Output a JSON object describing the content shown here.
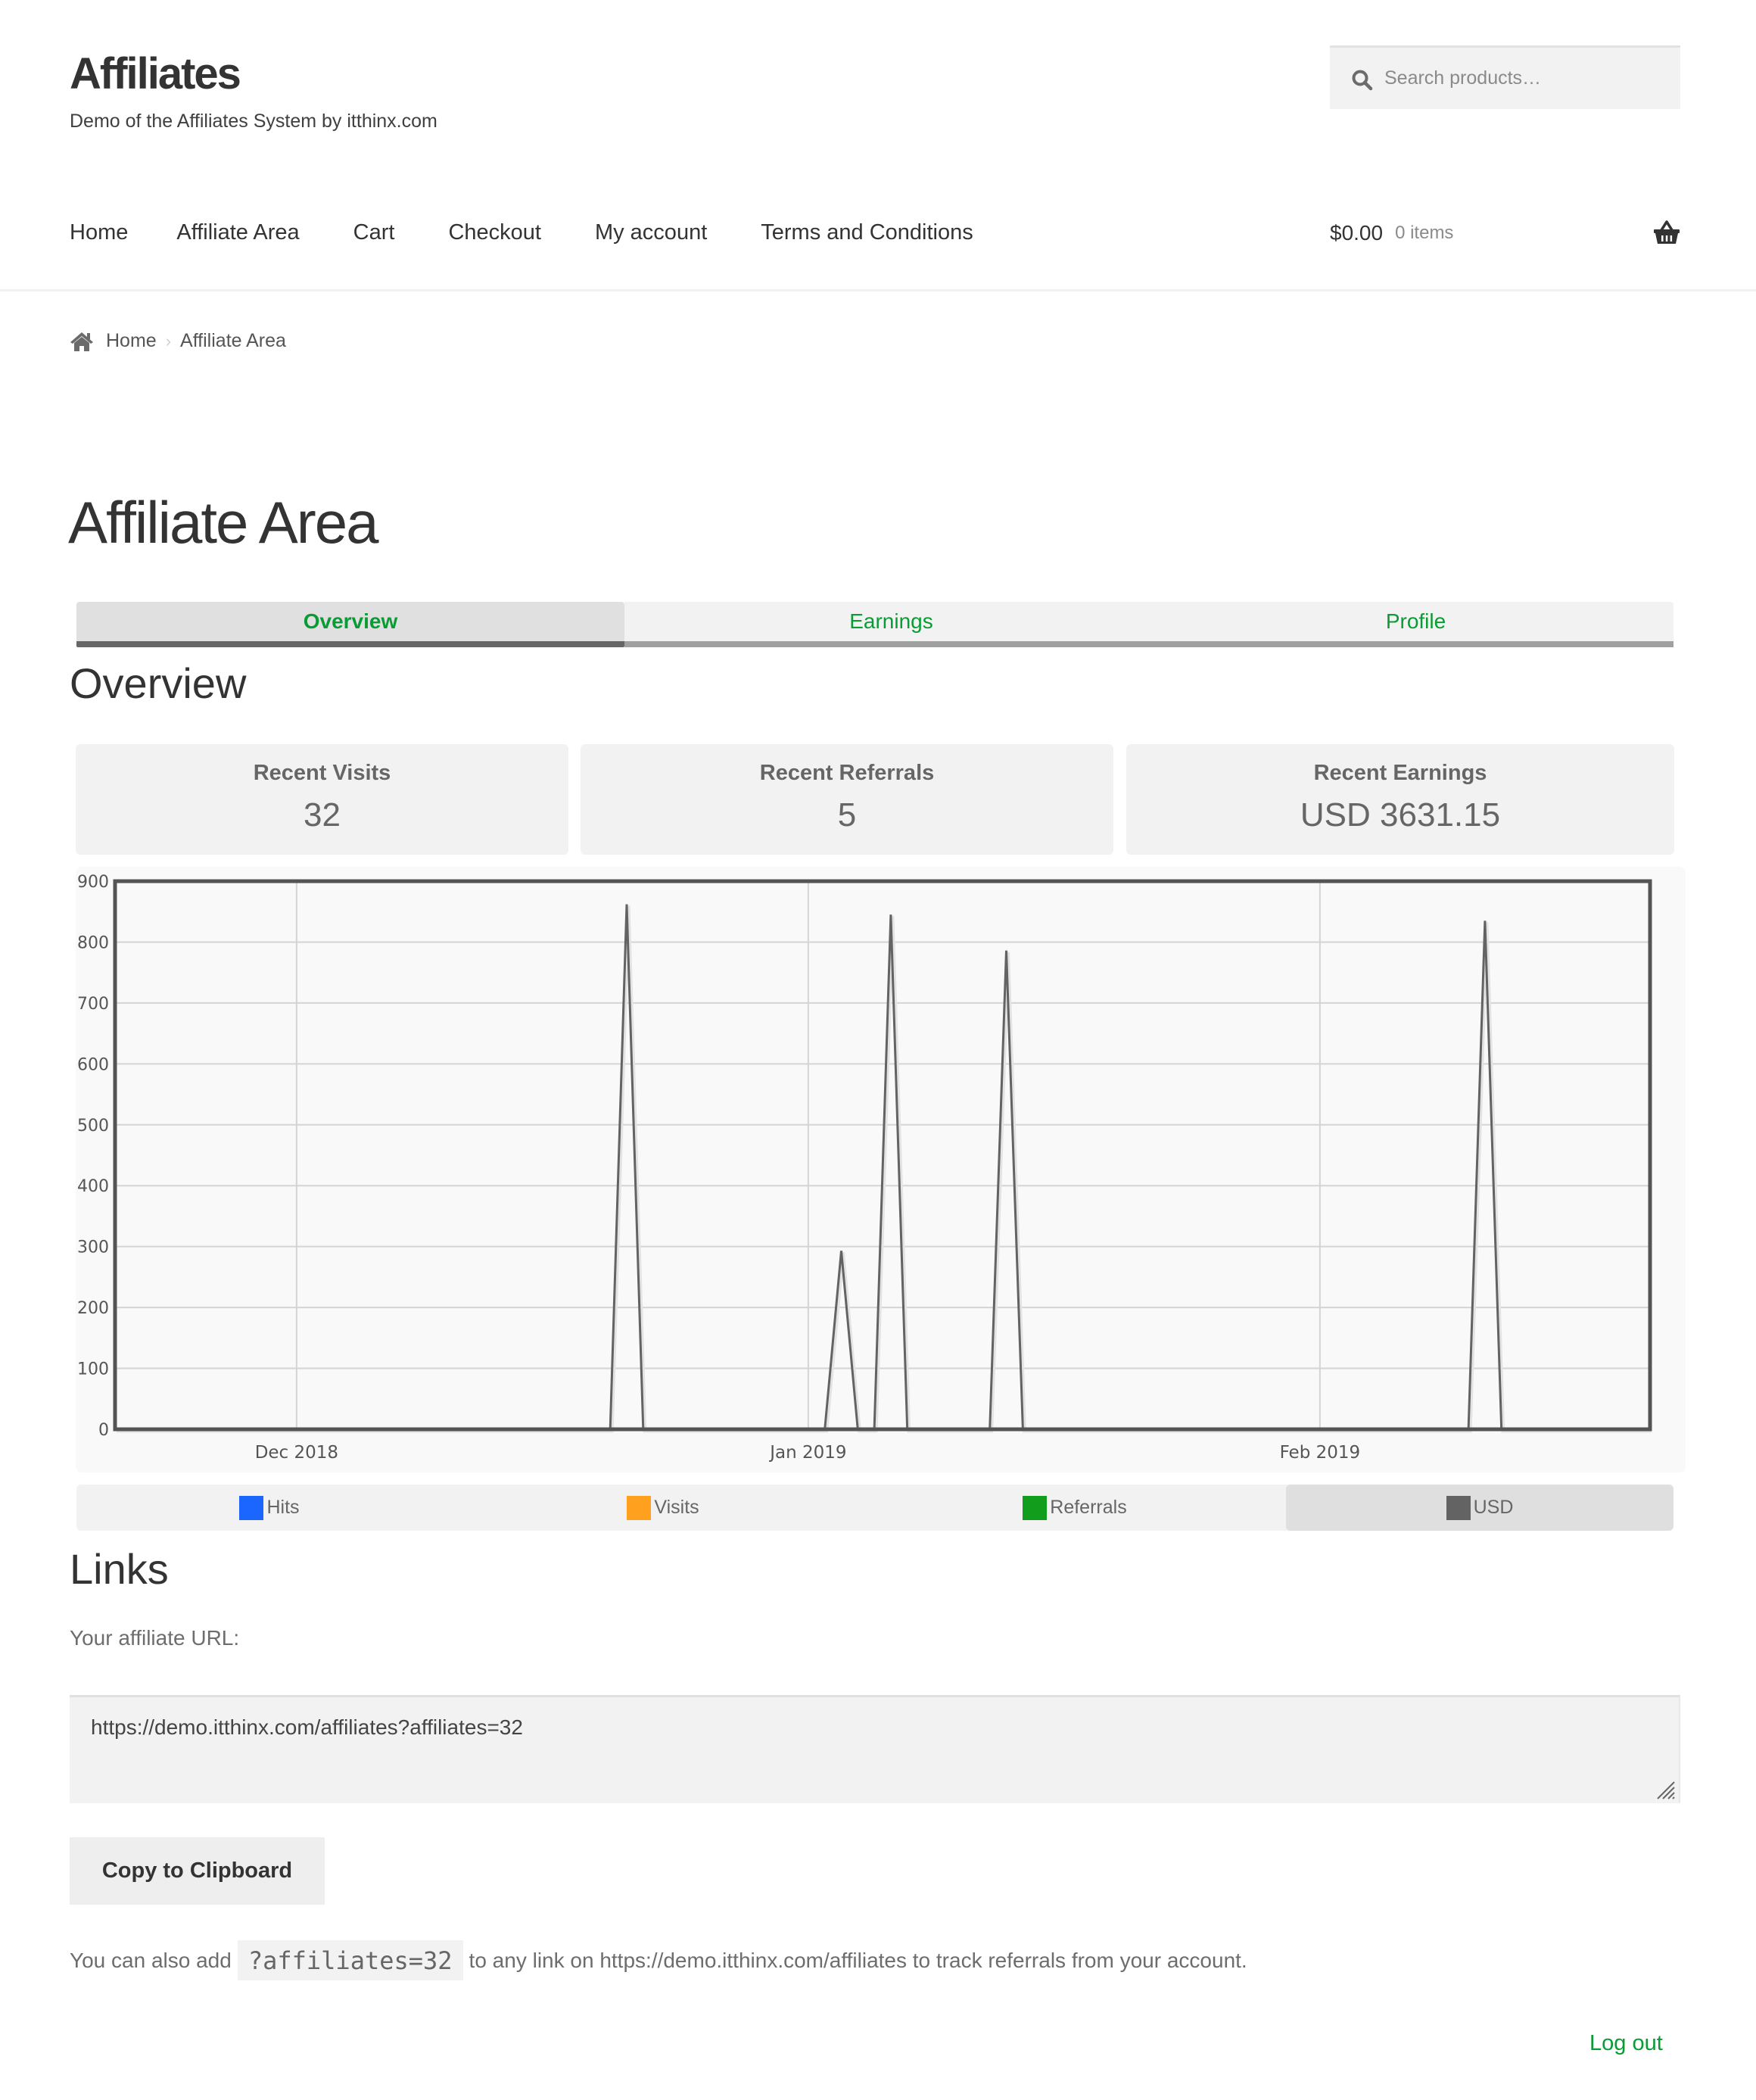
{
  "header": {
    "site_title": "Affiliates",
    "site_description": "Demo of the Affiliates System by itthinx.com",
    "search": {
      "placeholder": "Search products…",
      "value": "",
      "icon": "search-icon"
    },
    "cart": {
      "amount": "$0.00",
      "count": "0 items",
      "icon": "basket-icon"
    }
  },
  "nav": {
    "items": [
      {
        "label": "Home"
      },
      {
        "label": "Affiliate Area"
      },
      {
        "label": "Cart"
      },
      {
        "label": "Checkout"
      },
      {
        "label": "My account"
      },
      {
        "label": "Terms and Conditions"
      }
    ]
  },
  "breadcrumb": {
    "icon": "home-icon",
    "items": [
      {
        "label": "Home"
      },
      {
        "label": "Affiliate Area"
      }
    ],
    "separator": "›"
  },
  "page": {
    "title": "Affiliate Area",
    "tabs": [
      {
        "label": "Overview",
        "active": true
      },
      {
        "label": "Earnings",
        "active": false
      },
      {
        "label": "Profile",
        "active": false
      }
    ]
  },
  "overview": {
    "heading": "Overview",
    "stats": [
      {
        "label": "Recent Visits",
        "value": "32"
      },
      {
        "label": "Recent Referrals",
        "value": "5"
      },
      {
        "label": "Recent Earnings",
        "value": "USD 3631.15"
      }
    ]
  },
  "legend": {
    "items": [
      {
        "label": "Hits",
        "color": "#1a66ff",
        "active": false
      },
      {
        "label": "Visits",
        "color": "#ffa01e",
        "active": false
      },
      {
        "label": "Referrals",
        "color": "#129e1c",
        "active": false
      },
      {
        "label": "USD",
        "color": "#636363",
        "active": true
      }
    ]
  },
  "chart_data": {
    "type": "line",
    "title": "",
    "xlabel": "",
    "ylabel": "",
    "x_range": [
      "2018-11-20",
      "2019-02-21"
    ],
    "ylim": [
      0,
      900
    ],
    "y_ticks": [
      0,
      100,
      200,
      300,
      400,
      500,
      600,
      700,
      800,
      900
    ],
    "y_tick_labels": [
      "0",
      "100",
      "200",
      "300",
      "400",
      "500",
      "600",
      "700",
      "800",
      "900"
    ],
    "x_ticks": [
      {
        "date": "2018-12-01",
        "label": "Dec 2018"
      },
      {
        "date": "2019-01-01",
        "label": "Jan 2019"
      },
      {
        "date": "2019-02-01",
        "label": "Feb 2019"
      }
    ],
    "grid": true,
    "legend_position": "bottom",
    "series": [
      {
        "name": "USD",
        "color": "#636363",
        "visible": true,
        "nonzero_points": [
          {
            "date": "2018-12-21",
            "value": 862
          },
          {
            "date": "2019-01-03",
            "value": 293
          },
          {
            "date": "2019-01-06",
            "value": 845
          },
          {
            "date": "2019-01-13",
            "value": 786
          },
          {
            "date": "2019-02-11",
            "value": 835
          }
        ],
        "default_value": 0
      }
    ]
  },
  "links": {
    "heading": "Links",
    "url_label": "Your affiliate URL:",
    "url_value": "https://demo.itthinx.com/affiliates?affiliates=32",
    "copy_button": "Copy to Clipboard",
    "also_prefix": "You can also add",
    "also_code": "?affiliates=32",
    "also_suffix": "to any link on https://demo.itthinx.com/affiliates to track referrals from your account."
  },
  "footer": {
    "logout": "Log out"
  },
  "colors": {
    "accent_green": "#0a9c34",
    "text_dark": "#333333",
    "panel_bg": "#f2f2f2"
  }
}
